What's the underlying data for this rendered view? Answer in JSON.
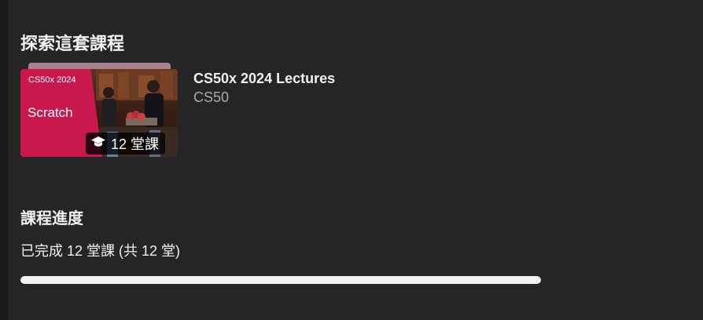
{
  "explore": {
    "title": "探索這套課程"
  },
  "course": {
    "thumbnail_badge": "CS50x 2024",
    "thumbnail_topic": "Scratch",
    "lesson_count": "12 堂課",
    "title": "CS50x 2024 Lectures",
    "channel": "CS50",
    "icon": "graduation-cap-icon"
  },
  "progress": {
    "heading": "課程進度",
    "summary": "已完成 12 堂課 (共 12 堂)",
    "completed": 12,
    "total": 12,
    "fraction": 1.0
  },
  "colors": {
    "background": "#252525",
    "thumbnail_accent": "#c9184e",
    "progress_fill": "#f1f1f1"
  }
}
